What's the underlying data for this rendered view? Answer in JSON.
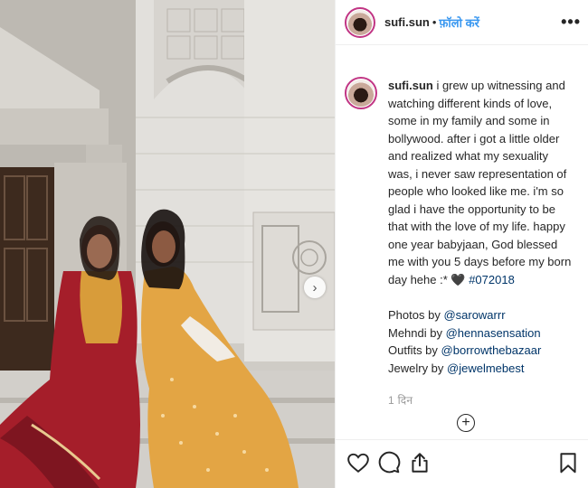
{
  "post": {
    "username": "sufi.sun",
    "follow_label": "फ़ॉलो करें",
    "separator": "•",
    "more_label": "•••",
    "next_label": "›",
    "add_comment_label": "+"
  },
  "caption": {
    "username": "sufi.sun",
    "text": " i grew up witnessing and watching different kinds of love, some in my family and some in bollywood. after i got a little older and realized what my sexuality was, i never saw representation of people who looked like me. i'm so glad i have the opportunity to be that with the love of my life. happy one year babyjaan, God blessed me with you 5 days before my born day hehe :* 🖤 ",
    "hashtag": "#072018",
    "credits": [
      {
        "label": "Photos by ",
        "handle": "@sarowarrr"
      },
      {
        "label": "Mehndi by ",
        "handle": "@hennasensation"
      },
      {
        "label": "Outfits by ",
        "handle": "@borrowthebazaar"
      },
      {
        "label": "Jewelry by ",
        "handle": "@jewelmebest"
      }
    ],
    "time": "1 दिन"
  },
  "actions": {
    "like_icon": "heart-icon",
    "comment_icon": "comment-icon",
    "share_icon": "share-icon",
    "save_icon": "bookmark-icon"
  },
  "colors": {
    "link": "#003569",
    "follow": "#3897f0",
    "story_ring": "#c13584"
  }
}
